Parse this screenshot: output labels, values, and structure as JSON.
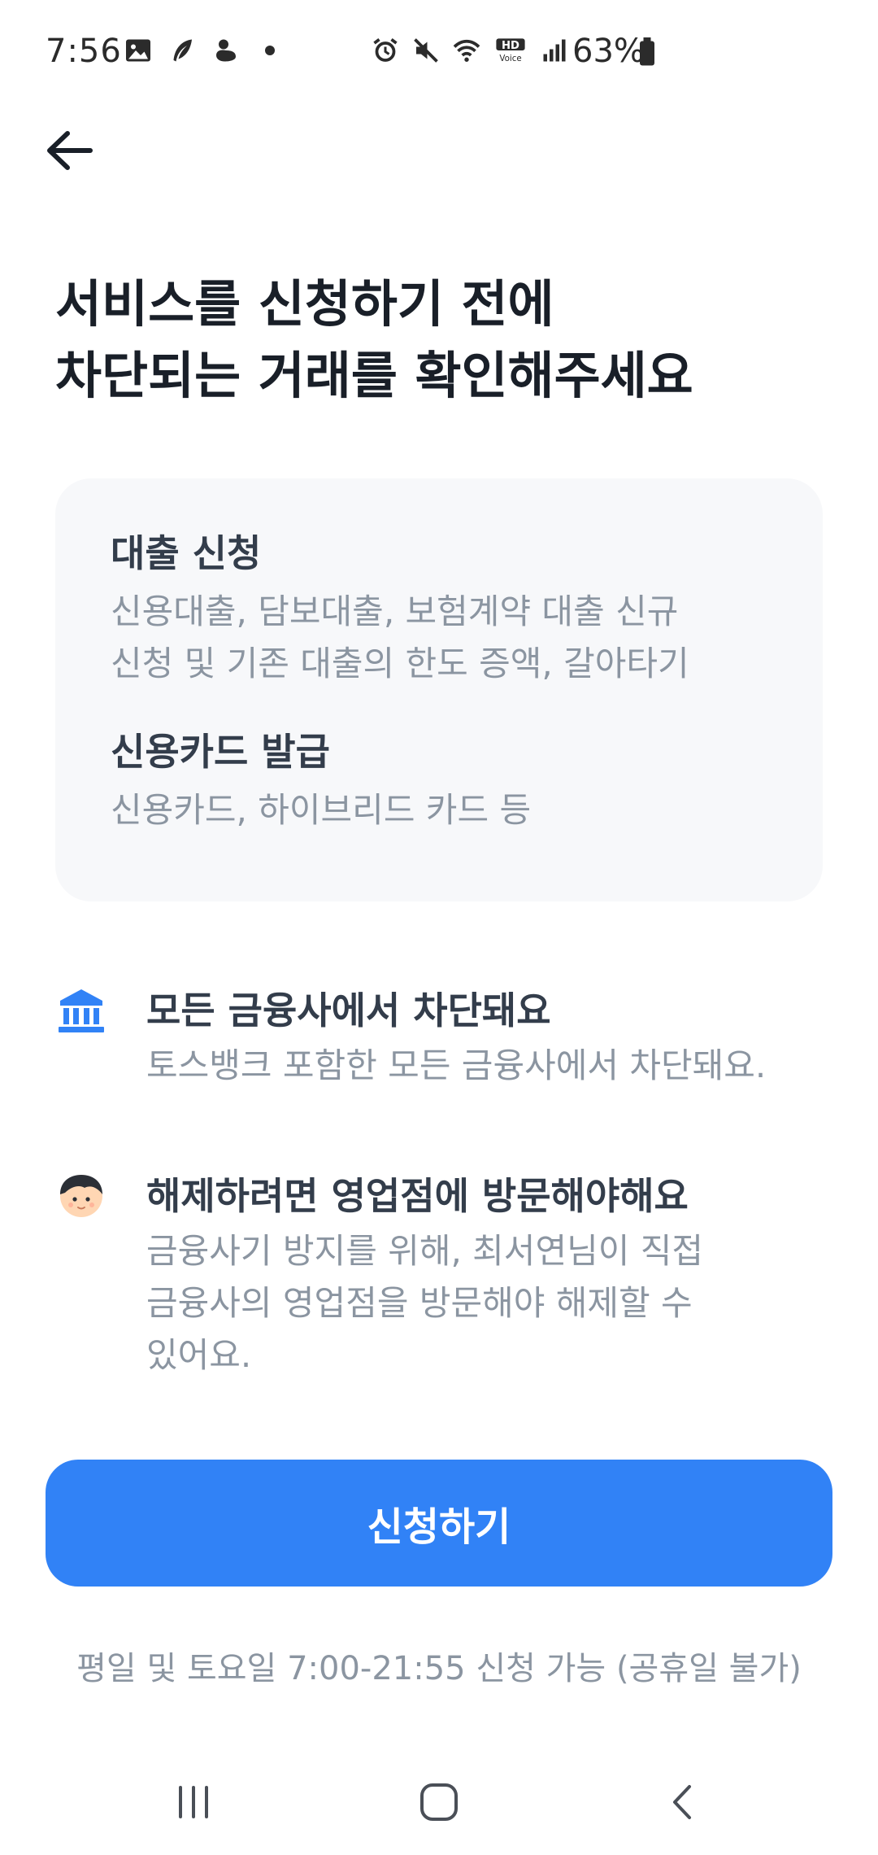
{
  "status_bar": {
    "time": "7:56",
    "battery": "63%",
    "left_icons": [
      "gallery-icon",
      "feather-icon",
      "duck-icon",
      "dot-icon"
    ],
    "right_icons": [
      "alarm-icon",
      "mute-icon",
      "wifi-icon",
      "hd-voice-icon",
      "signal-icon",
      "battery-icon"
    ],
    "hd_label": "HD",
    "voice_label": "Voice"
  },
  "header": {
    "back_icon": "arrow-left-icon"
  },
  "headline": {
    "line1": "서비스를 신청하기 전에",
    "line2": "차단되는 거래를 확인해주세요"
  },
  "info_card": {
    "loan": {
      "title": "대출 신청",
      "desc_line1": "신용대출, 담보대출, 보험계약 대출 신규",
      "desc_line2": "신청 및 기존 대출의 한도 증액, 갈아타기"
    },
    "card": {
      "title": "신용카드 발급",
      "desc_line1": "신용카드, 하이브리드 카드 등"
    }
  },
  "notices": {
    "bank": {
      "icon": "bank-icon",
      "title": "모든 금융사에서 차단돼요",
      "desc_line1": "토스뱅크 포함한 모든 금융사에서 차단돼요."
    },
    "visit": {
      "icon": "person-icon",
      "title": "해제하려면 영업점에 방문해야해요",
      "desc_line1": "금융사기 방지를 위해, 최서연님이 직접",
      "desc_line2": "금융사의 영업점을 방문해야 해제할 수",
      "desc_line3": "있어요."
    }
  },
  "cta": {
    "apply_label": "신청하기",
    "hours_note": "평일 및 토요일 7:00-21:55 신청 가능 (공휴일 불가)"
  },
  "colors": {
    "accent": "#3182f6",
    "card_bg": "#f7f8fa",
    "title_text": "#191f28",
    "secondary_text": "#8b95a1"
  },
  "nav_bar": {
    "items": [
      "recent-apps-icon",
      "home-icon",
      "back-icon"
    ]
  }
}
